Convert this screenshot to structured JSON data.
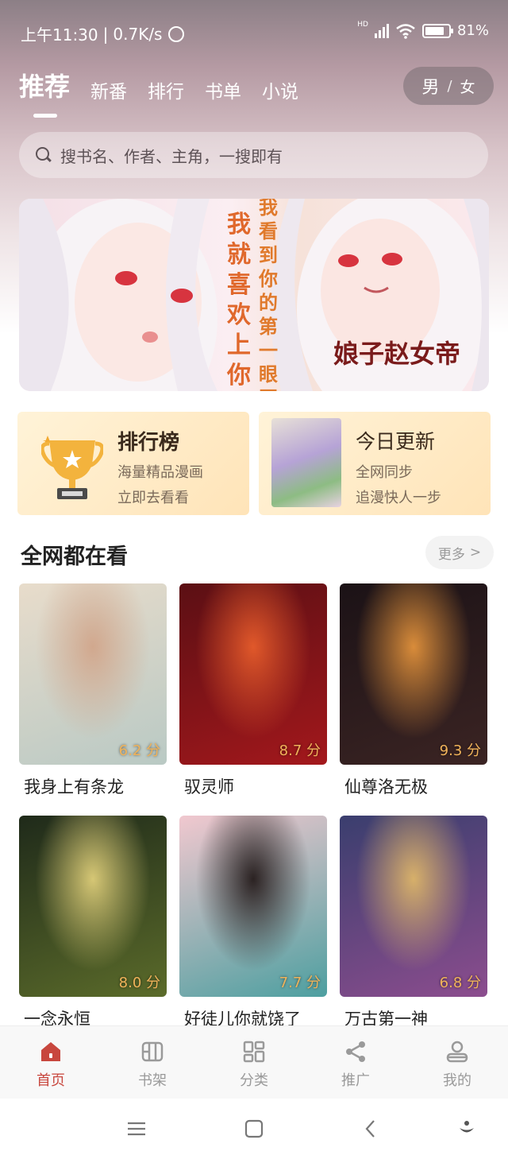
{
  "status_bar": {
    "time": "上午11:30",
    "speed": "0.7K/s",
    "network": "HD",
    "battery": "81%",
    "battery_level": 0.81
  },
  "header": {
    "tabs": [
      {
        "label": "推荐",
        "active": true
      },
      {
        "label": "新番",
        "active": false
      },
      {
        "label": "排行",
        "active": false
      },
      {
        "label": "书单",
        "active": false
      },
      {
        "label": "小说",
        "active": false
      }
    ],
    "gender_male": "男",
    "gender_sep": "/",
    "gender_female": "女"
  },
  "search": {
    "placeholder": "搜书名、作者、主角，一搜即有",
    "icon": "search-icon"
  },
  "banner": {
    "caption_line1": "我就喜欢上你了",
    "caption_line2": "我看到你的第一眼开始",
    "logo_text": "娘子赵女帝"
  },
  "cards": {
    "ranking": {
      "title": "排行榜",
      "line1": "海量精品漫画",
      "line2": "立即去看看"
    },
    "today": {
      "title": "今日更新",
      "line1": "全网同步",
      "line2": "追漫快人一步"
    }
  },
  "section": {
    "title": "全网都在看",
    "more": "更多",
    "more_icon": "chevron-right-icon"
  },
  "comics": [
    {
      "title": "我身上有条龙",
      "score": "6.2 分",
      "colors": [
        "#e8dccb",
        "#b9c9c4",
        "#d1a88e"
      ]
    },
    {
      "title": "驭灵师",
      "score": "8.7 分",
      "colors": [
        "#5b0f14",
        "#a3181c",
        "#e0582a"
      ]
    },
    {
      "title": "仙尊洛无极",
      "score": "9.3 分",
      "colors": [
        "#1b1216",
        "#3b2423",
        "#d98c3a"
      ]
    },
    {
      "title": "一念永恒",
      "score": "8.0 分",
      "colors": [
        "#1f2a1a",
        "#5b6b2a",
        "#d6c775"
      ]
    },
    {
      "title": "好徒儿你就饶了",
      "score": "7.7 分",
      "colors": [
        "#f1c8cf",
        "#4d9fa0",
        "#2b2222"
      ]
    },
    {
      "title": "万古第一神",
      "score": "6.8 分",
      "colors": [
        "#3a3e6e",
        "#8c4d8e",
        "#d7b06a"
      ]
    }
  ],
  "tabbar": [
    {
      "label": "首页",
      "icon": "home-icon",
      "active": true
    },
    {
      "label": "书架",
      "icon": "bookshelf-icon",
      "active": false
    },
    {
      "label": "分类",
      "icon": "category-icon",
      "active": false
    },
    {
      "label": "推广",
      "icon": "share-icon",
      "active": false
    },
    {
      "label": "我的",
      "icon": "profile-icon",
      "active": false
    }
  ],
  "colors": {
    "accent": "#c8473e",
    "score": "#f0b35a"
  }
}
